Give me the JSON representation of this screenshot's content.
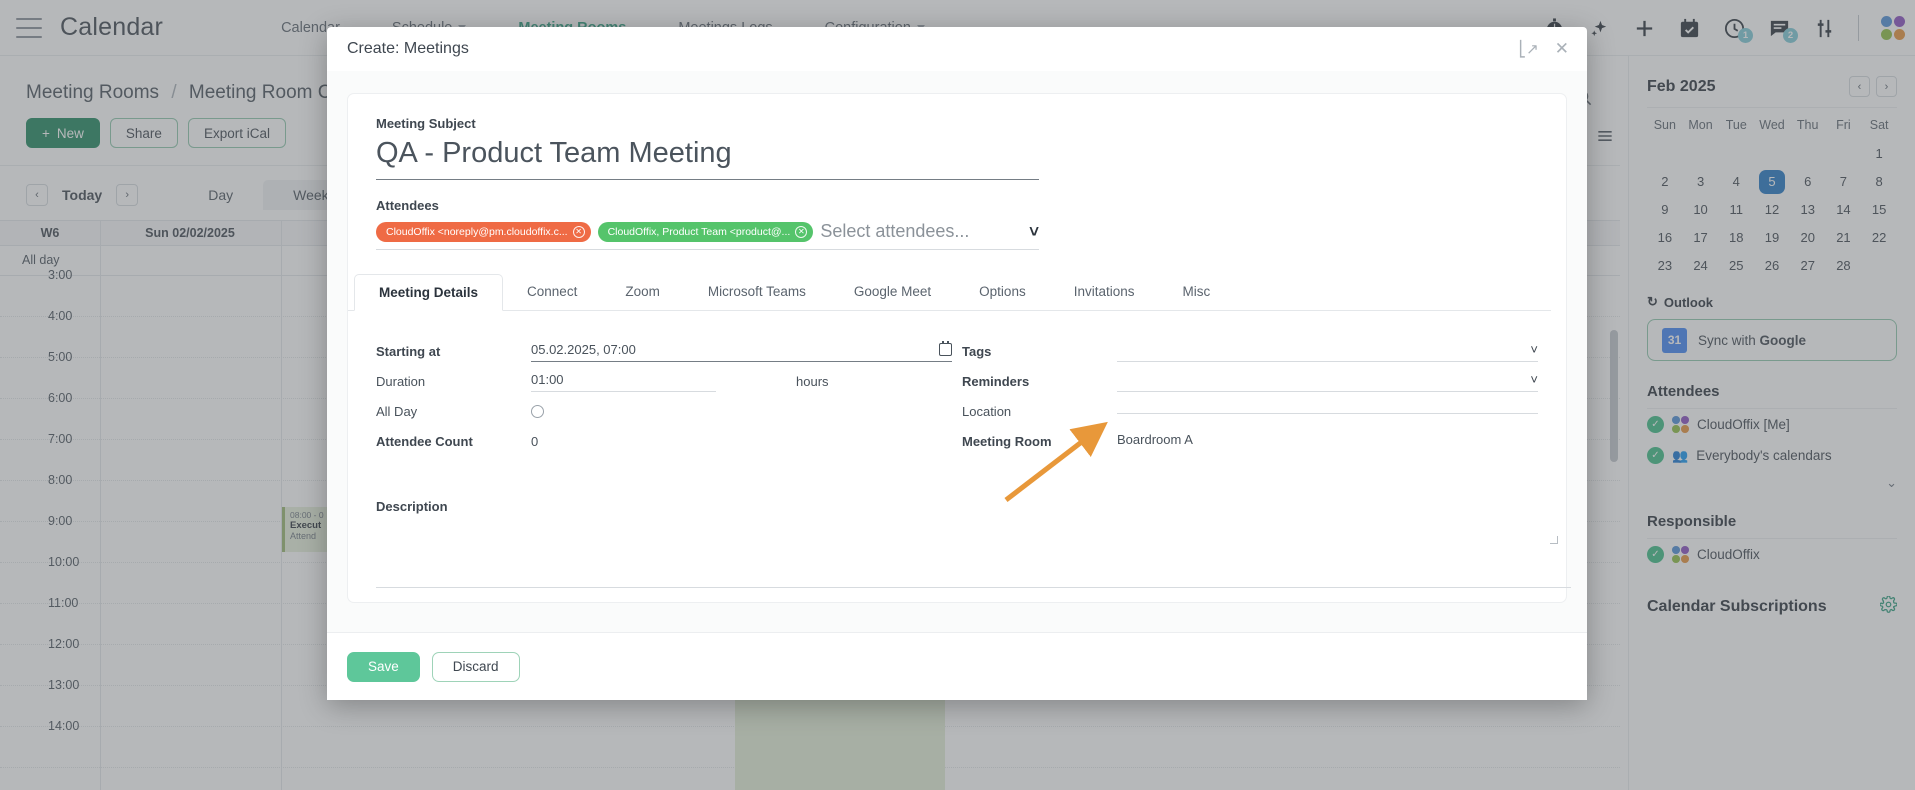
{
  "topnav": {
    "brand": "Calendar",
    "links": [
      {
        "label": "Calendar",
        "has_caret": false,
        "active": false
      },
      {
        "label": "Schedule",
        "has_caret": true,
        "active": false
      },
      {
        "label": "Meeting Rooms",
        "has_caret": false,
        "active": true
      },
      {
        "label": "Meetings Logs",
        "has_caret": false,
        "active": false
      },
      {
        "label": "Configuration",
        "has_caret": true,
        "active": false
      }
    ],
    "icons": [
      {
        "name": "stopwatch-icon",
        "badge": ""
      },
      {
        "name": "sparkle-ai-icon",
        "badge": ""
      },
      {
        "name": "plus-icon",
        "badge": ""
      },
      {
        "name": "calendar-check-icon",
        "badge": ""
      },
      {
        "name": "clock-icon",
        "badge": "1"
      },
      {
        "name": "chat-icon",
        "badge": "2"
      },
      {
        "name": "sliders-icon",
        "badge": ""
      }
    ]
  },
  "page": {
    "breadcrumb_parent": "Meeting Rooms",
    "breadcrumb_sep": "/",
    "breadcrumb_current": "Meeting Room Calendar",
    "buttons": {
      "new": "New",
      "share": "Share",
      "export": "Export iCal"
    },
    "viewbar": {
      "prev": "‹",
      "today": "Today",
      "next": "›",
      "views": [
        {
          "label": "Day",
          "active": false
        },
        {
          "label": "Week",
          "active": true
        }
      ]
    },
    "grid": {
      "week_label": "W6",
      "day_label": "Sun 02/02/2025",
      "allday_label": "All day",
      "times": [
        "3:00",
        "4:00",
        "5:00",
        "6:00",
        "7:00",
        "8:00",
        "9:00",
        "10:00",
        "11:00",
        "12:00",
        "13:00",
        "14:00"
      ]
    },
    "event": {
      "time": "08:00 - 0",
      "title": "Execut",
      "attendees": "Attend"
    }
  },
  "sidebar": {
    "calendar": {
      "month": "Feb 2025",
      "prev": "‹",
      "next": "›",
      "dow": [
        "Sun",
        "Mon",
        "Tue",
        "Wed",
        "Thu",
        "Fri",
        "Sat"
      ],
      "leading_blanks": 6,
      "days": [
        1,
        2,
        3,
        4,
        5,
        6,
        7,
        8,
        9,
        10,
        11,
        12,
        13,
        14,
        15,
        16,
        17,
        18,
        19,
        20,
        21,
        22,
        23,
        24,
        25,
        26,
        27,
        28
      ],
      "selected_day": 5,
      "selected_color": "#2277c4"
    },
    "outlook_label": "Outlook",
    "sync_google": {
      "prefix": "Sync with ",
      "brand": "Google",
      "icon_text": "31"
    },
    "attendees_title": "Attendees",
    "attendees": [
      {
        "label": "CloudOffix [Me]",
        "avatar": "dots"
      },
      {
        "label": "Everybody's calendars",
        "avatar": "group"
      }
    ],
    "attendees_more": "⌄",
    "responsible_title": "Responsible",
    "responsible": [
      {
        "label": "CloudOffix",
        "avatar": "dots"
      }
    ],
    "subscriptions_title": "Calendar Subscriptions"
  },
  "modal": {
    "title": "Create: Meetings",
    "maximize": "⤡",
    "close": "✕",
    "subject_label": "Meeting Subject",
    "subject_value": "QA - Product Team Meeting",
    "attendees_label": "Attendees",
    "attendee_chips": [
      {
        "text": "CloudOffix <noreply@pm.cloudoffix.c...",
        "color": "#ef6b45"
      },
      {
        "text": "CloudOffix, Product Team <product@...",
        "color": "#55c46b"
      }
    ],
    "attendees_placeholder": "Select attendees...",
    "tabs": [
      {
        "label": "Meeting Details",
        "active": true
      },
      {
        "label": "Connect",
        "active": false
      },
      {
        "label": "Zoom",
        "active": false
      },
      {
        "label": "Microsoft Teams",
        "active": false
      },
      {
        "label": "Google Meet",
        "active": false
      },
      {
        "label": "Options",
        "active": false
      },
      {
        "label": "Invitations",
        "active": false
      },
      {
        "label": "Misc",
        "active": false
      }
    ],
    "left_fields": {
      "starting_at_label": "Starting at",
      "starting_at_value": "05.02.2025, 07:00",
      "duration_label": "Duration",
      "duration_value": "01:00",
      "duration_unit": "hours",
      "all_day_label": "All Day",
      "all_day_checked": false,
      "attendee_count_label": "Attendee Count",
      "attendee_count_value": "0"
    },
    "right_fields": {
      "tags_label": "Tags",
      "tags_value": "",
      "reminders_label": "Reminders",
      "reminders_value": "",
      "location_label": "Location",
      "location_value": "",
      "meeting_room_label": "Meeting Room",
      "meeting_room_value": "Boardroom A"
    },
    "description_label": "Description",
    "description_value": "",
    "footer": {
      "save": "Save",
      "discard": "Discard"
    }
  },
  "annotation": {
    "arrow_color": "#e8983a",
    "points_to": "Boardroom A"
  }
}
